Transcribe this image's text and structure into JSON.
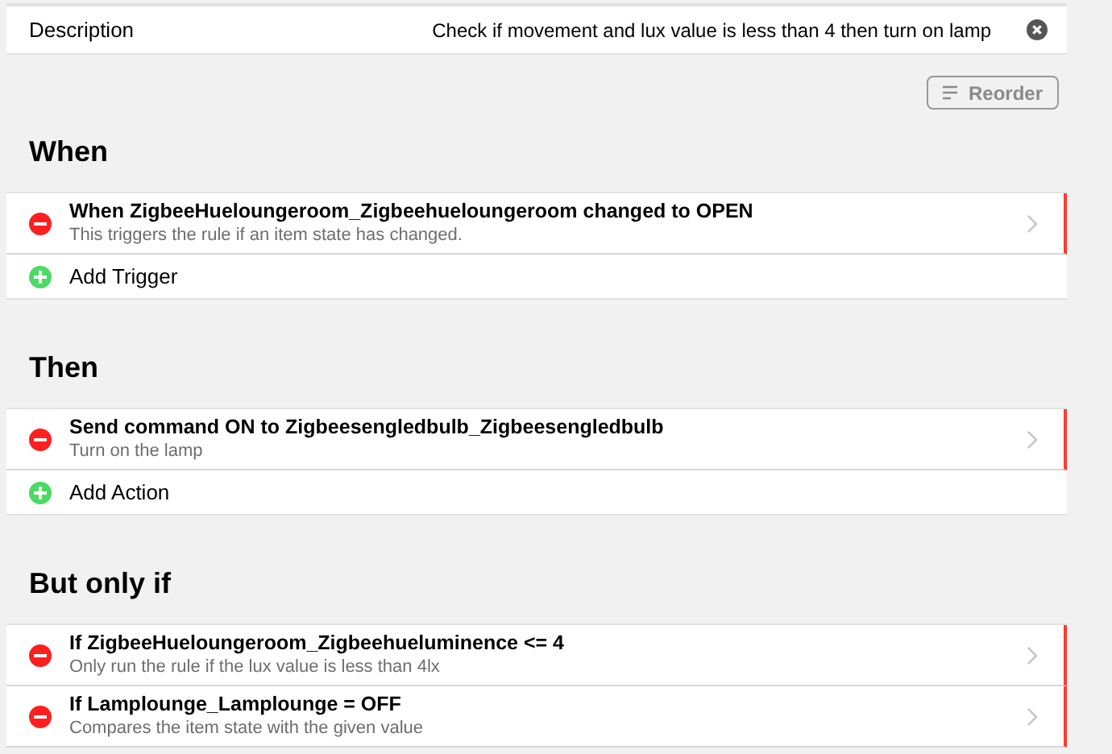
{
  "description": {
    "label": "Description",
    "value": "Check if movement and lux value is less than 4 then turn on lamp"
  },
  "reorder_button": {
    "label": "Reorder",
    "disabled": true
  },
  "sections": [
    {
      "title": "When",
      "items": [
        {
          "title": "When ZigbeeHueloungeroom_Zigbeehueloungeroom changed to OPEN",
          "description": "This triggers the rule if an item state has changed."
        }
      ],
      "add_label": "Add Trigger"
    },
    {
      "title": "Then",
      "items": [
        {
          "title": "Send command ON to Zigbeesengledbulb_Zigbeesengledbulb",
          "description": "Turn on the lamp"
        }
      ],
      "add_label": "Add Action"
    },
    {
      "title": "But only if",
      "items": [
        {
          "title": "If ZigbeeHueloungeroom_Zigbeehueluminence <= 4",
          "description": "Only run the rule if the lux value is less than 4lx"
        },
        {
          "title": "If Lamplounge_Lamplounge = OFF",
          "description": "Compares the item state with the given value"
        }
      ]
    }
  ]
}
